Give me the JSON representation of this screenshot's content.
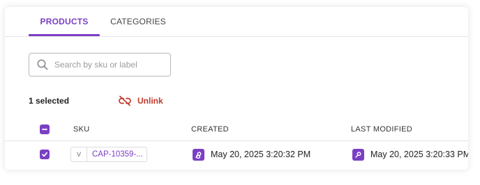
{
  "tabs": [
    {
      "label": "PRODUCTS",
      "active": true
    },
    {
      "label": "CATEGORIES",
      "active": false
    }
  ],
  "search": {
    "placeholder": "Search by sku or label",
    "value": ""
  },
  "selection": {
    "text": "1 selected",
    "unlink_label": "Unlink"
  },
  "table": {
    "columns": [
      "SKU",
      "CREATED",
      "LAST MODIFIED"
    ],
    "rows": [
      {
        "checked": true,
        "variant_tag": "V",
        "sku": "CAP-10359-...",
        "created": "May 20, 2025 3:20:32 PM",
        "last_modified": "May 20, 2025 3:20:33 PM"
      }
    ]
  },
  "colors": {
    "accent": "#7b3fc4",
    "danger": "#c0392b"
  },
  "icons": {
    "search": "search-icon",
    "unlink": "unlink-icon",
    "select_all": "minus-checkbox-icon",
    "row_check": "check-icon",
    "user": "user-avatar-icon"
  }
}
